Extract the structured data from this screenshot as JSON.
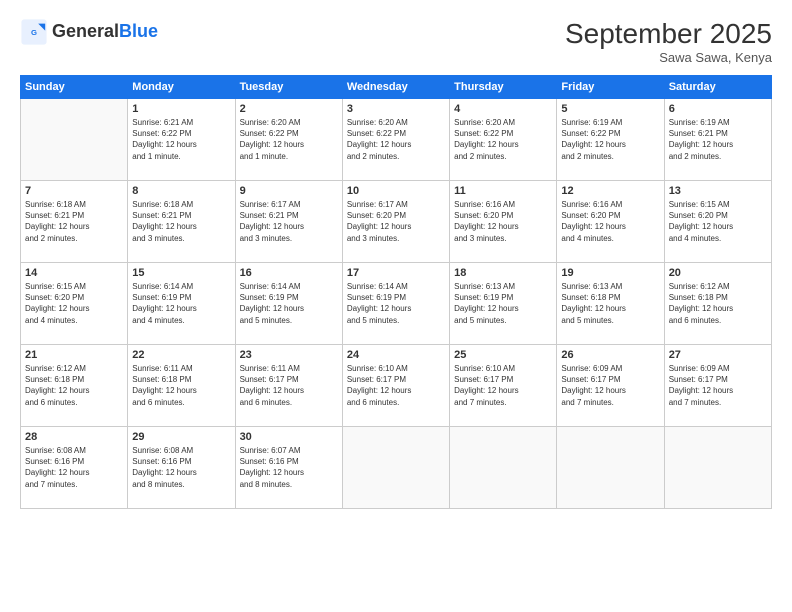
{
  "header": {
    "logo_general": "General",
    "logo_blue": "Blue",
    "month_title": "September 2025",
    "subtitle": "Sawa Sawa, Kenya"
  },
  "days_of_week": [
    "Sunday",
    "Monday",
    "Tuesday",
    "Wednesday",
    "Thursday",
    "Friday",
    "Saturday"
  ],
  "weeks": [
    [
      {
        "day": "",
        "info": ""
      },
      {
        "day": "1",
        "info": "Sunrise: 6:21 AM\nSunset: 6:22 PM\nDaylight: 12 hours\nand 1 minute."
      },
      {
        "day": "2",
        "info": "Sunrise: 6:20 AM\nSunset: 6:22 PM\nDaylight: 12 hours\nand 1 minute."
      },
      {
        "day": "3",
        "info": "Sunrise: 6:20 AM\nSunset: 6:22 PM\nDaylight: 12 hours\nand 2 minutes."
      },
      {
        "day": "4",
        "info": "Sunrise: 6:20 AM\nSunset: 6:22 PM\nDaylight: 12 hours\nand 2 minutes."
      },
      {
        "day": "5",
        "info": "Sunrise: 6:19 AM\nSunset: 6:22 PM\nDaylight: 12 hours\nand 2 minutes."
      },
      {
        "day": "6",
        "info": "Sunrise: 6:19 AM\nSunset: 6:21 PM\nDaylight: 12 hours\nand 2 minutes."
      }
    ],
    [
      {
        "day": "7",
        "info": "Sunrise: 6:18 AM\nSunset: 6:21 PM\nDaylight: 12 hours\nand 2 minutes."
      },
      {
        "day": "8",
        "info": "Sunrise: 6:18 AM\nSunset: 6:21 PM\nDaylight: 12 hours\nand 3 minutes."
      },
      {
        "day": "9",
        "info": "Sunrise: 6:17 AM\nSunset: 6:21 PM\nDaylight: 12 hours\nand 3 minutes."
      },
      {
        "day": "10",
        "info": "Sunrise: 6:17 AM\nSunset: 6:20 PM\nDaylight: 12 hours\nand 3 minutes."
      },
      {
        "day": "11",
        "info": "Sunrise: 6:16 AM\nSunset: 6:20 PM\nDaylight: 12 hours\nand 3 minutes."
      },
      {
        "day": "12",
        "info": "Sunrise: 6:16 AM\nSunset: 6:20 PM\nDaylight: 12 hours\nand 4 minutes."
      },
      {
        "day": "13",
        "info": "Sunrise: 6:15 AM\nSunset: 6:20 PM\nDaylight: 12 hours\nand 4 minutes."
      }
    ],
    [
      {
        "day": "14",
        "info": "Sunrise: 6:15 AM\nSunset: 6:20 PM\nDaylight: 12 hours\nand 4 minutes."
      },
      {
        "day": "15",
        "info": "Sunrise: 6:14 AM\nSunset: 6:19 PM\nDaylight: 12 hours\nand 4 minutes."
      },
      {
        "day": "16",
        "info": "Sunrise: 6:14 AM\nSunset: 6:19 PM\nDaylight: 12 hours\nand 5 minutes."
      },
      {
        "day": "17",
        "info": "Sunrise: 6:14 AM\nSunset: 6:19 PM\nDaylight: 12 hours\nand 5 minutes."
      },
      {
        "day": "18",
        "info": "Sunrise: 6:13 AM\nSunset: 6:19 PM\nDaylight: 12 hours\nand 5 minutes."
      },
      {
        "day": "19",
        "info": "Sunrise: 6:13 AM\nSunset: 6:18 PM\nDaylight: 12 hours\nand 5 minutes."
      },
      {
        "day": "20",
        "info": "Sunrise: 6:12 AM\nSunset: 6:18 PM\nDaylight: 12 hours\nand 6 minutes."
      }
    ],
    [
      {
        "day": "21",
        "info": "Sunrise: 6:12 AM\nSunset: 6:18 PM\nDaylight: 12 hours\nand 6 minutes."
      },
      {
        "day": "22",
        "info": "Sunrise: 6:11 AM\nSunset: 6:18 PM\nDaylight: 12 hours\nand 6 minutes."
      },
      {
        "day": "23",
        "info": "Sunrise: 6:11 AM\nSunset: 6:17 PM\nDaylight: 12 hours\nand 6 minutes."
      },
      {
        "day": "24",
        "info": "Sunrise: 6:10 AM\nSunset: 6:17 PM\nDaylight: 12 hours\nand 6 minutes."
      },
      {
        "day": "25",
        "info": "Sunrise: 6:10 AM\nSunset: 6:17 PM\nDaylight: 12 hours\nand 7 minutes."
      },
      {
        "day": "26",
        "info": "Sunrise: 6:09 AM\nSunset: 6:17 PM\nDaylight: 12 hours\nand 7 minutes."
      },
      {
        "day": "27",
        "info": "Sunrise: 6:09 AM\nSunset: 6:17 PM\nDaylight: 12 hours\nand 7 minutes."
      }
    ],
    [
      {
        "day": "28",
        "info": "Sunrise: 6:08 AM\nSunset: 6:16 PM\nDaylight: 12 hours\nand 7 minutes."
      },
      {
        "day": "29",
        "info": "Sunrise: 6:08 AM\nSunset: 6:16 PM\nDaylight: 12 hours\nand 8 minutes."
      },
      {
        "day": "30",
        "info": "Sunrise: 6:07 AM\nSunset: 6:16 PM\nDaylight: 12 hours\nand 8 minutes."
      },
      {
        "day": "",
        "info": ""
      },
      {
        "day": "",
        "info": ""
      },
      {
        "day": "",
        "info": ""
      },
      {
        "day": "",
        "info": ""
      }
    ]
  ]
}
